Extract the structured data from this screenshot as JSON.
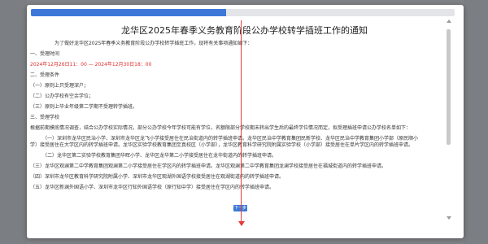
{
  "colors": {
    "accent": "#3d78d8",
    "highlight_red": "#e12d2d",
    "annotation_arrow": "#e23a3a",
    "backdrop": "#7f8286"
  },
  "progress": {
    "value_fraction": 0.46
  },
  "document": {
    "title": "龙华区2025年春季义务教育阶段公办学校转学插班工作的通知",
    "intro": "为了做好龙华区2025年春季义务教育阶段公办学校转学插班工作，现将有关事项通知如下：",
    "section1_heading": "一、受理时间",
    "section1_time": "2024年12月26日11：00 — 2024年12月30日18：00",
    "section2_heading": "二、受理条件",
    "cond1": "（一）原则上只受理深户；",
    "cond2": "（二）公办学校有空余学位；",
    "cond3": "（三）原则上毕业年级第二学期不受理转学插班。",
    "section3_heading": "三、受理学校",
    "section3_desc": "根据前期摸底情况调查，结合公办学校实际情况，部分公办学校今年学校可能有学位，名额限部分学校期末转出学生后的最终学位情况而定，拟受理插班申请公办学校名单如下：",
    "item1_a": "（一）深圳市龙华区民治小学、深圳市龙华区龙飞小学接受居住在民治街道内的转学插班申请。龙华区民治中学教育集团民新学校、龙华区民治中学教育集团小学部（原民顺小",
    "item1_b": "学）接受居住在大学区内的转学插班申请。龙华区实验学校教育集团至真校区（小学部），龙华区教育科学研究院附属实验学校（小学部）接受居住在单片学区内的转学插班申请。",
    "item2": "（二）龙华区第二实验学校教育集团华晖小学、龙华区龙华第二小学接受居住在龙华街道内的转学插班申请。",
    "item3": "（三）龙华区观澜第二中学教育集团观澜第二小学接受居住在学区内的转学插班申请。龙华区观澜第二中学教育集团龙澜学校接受居住在福城街道内的转学插班申请。",
    "item4": "（四）深圳市龙华区教育科学研究院附属小学、深圳市龙华区观湖外国语学校接受居住在观湖街道内的转学插班申请。",
    "item5": "（五）龙华区新澜外国语小学、深圳市龙华区行知外国语学校（原行知中学）接受居住在学区内的转学插班申请。"
  },
  "buttons": {
    "next_label": "下一步"
  }
}
